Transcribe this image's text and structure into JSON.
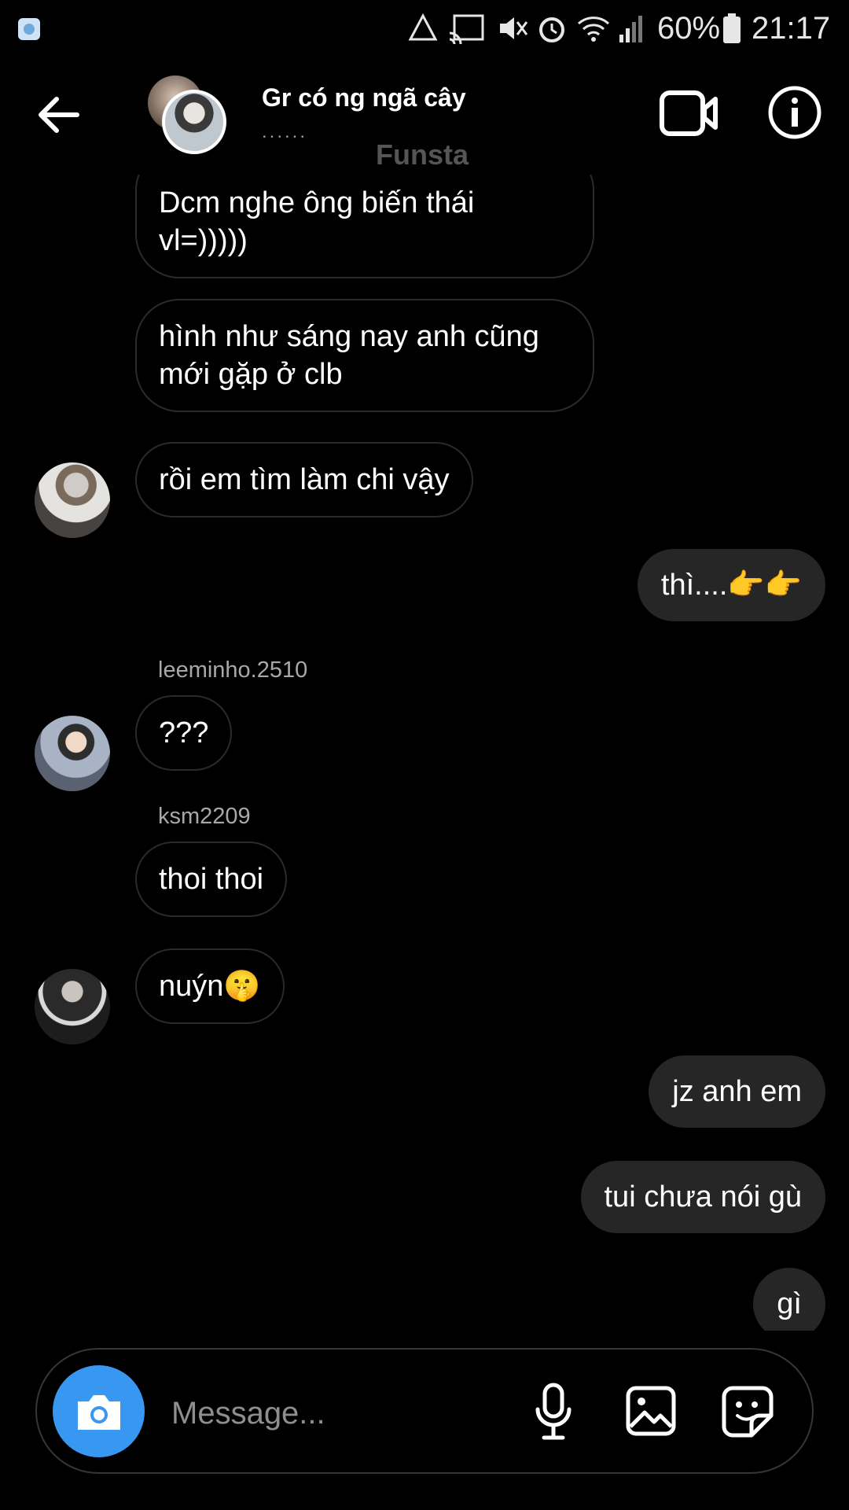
{
  "status_bar": {
    "battery": "60%",
    "time": "21:17"
  },
  "header": {
    "title": "Gr có ng ngã cây",
    "subtitle": "......",
    "overlay_label": "Funsta"
  },
  "messages": {
    "m1": "Dcm nghe ông biến thái vl=)))))",
    "m2": "hình như sáng nay anh cũng mới gặp ở clb",
    "m3": "rồi em tìm làm chi vậy",
    "m4": "thì....👉👉",
    "user1": "leeminho.2510",
    "m5": "???",
    "user2": "ksm2209",
    "m6": "thoi thoi",
    "m7": "nuýn🤫",
    "m8": "jz anh em",
    "m9": "tui chưa nói gù",
    "m10": "gì"
  },
  "composer": {
    "placeholder": "Message..."
  },
  "colors": {
    "accent": "#3897f0",
    "my_bubble": "#262626",
    "background": "#000000"
  }
}
